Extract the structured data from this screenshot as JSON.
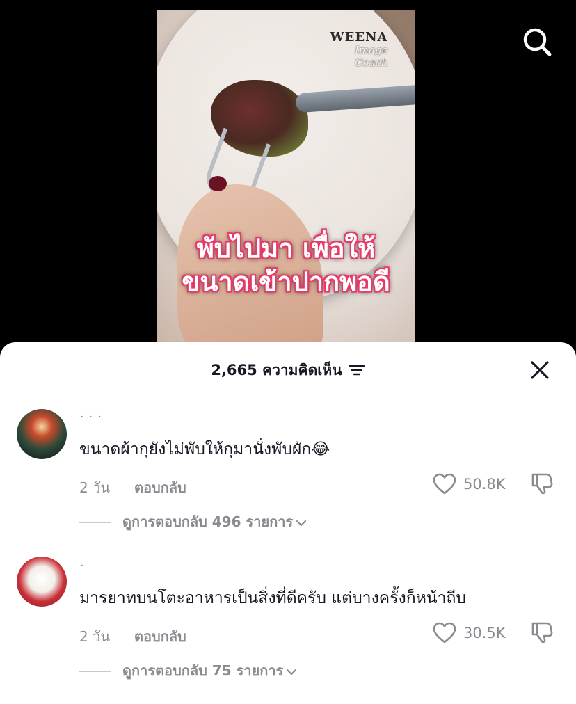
{
  "video": {
    "watermark_line1": "WEENA",
    "watermark_line2": "Image",
    "watermark_line3": "Coach",
    "caption_line1": "พับไปมา เพื่อให้",
    "caption_line2": "ขนาดเข้าปากพอดี"
  },
  "header": {
    "search_icon": "search-icon"
  },
  "comments_sheet": {
    "count_title": "2,665 ความคิดเห็น",
    "filter_icon": "filter-icon",
    "close_icon": "close-icon"
  },
  "comments": [
    {
      "username": "· · ·",
      "text": "ขนาดผ้ากุยังไม่พับให้กุมานั่งพับผัก😂",
      "time": "2 วัน",
      "reply_label": "ตอบกลับ",
      "likes": "50.8K",
      "view_replies": "ดูการตอบกลับ 496 รายการ"
    },
    {
      "username": "·",
      "text": "มารยาทบนโตะอาหารเป็นสิ่งที่ดีครับ แต่บางครั้งก็หน้าถีบ",
      "time": "2 วัน",
      "reply_label": "ตอบกลับ",
      "likes": "30.5K",
      "view_replies": "ดูการตอบกลับ 75 รายการ"
    }
  ],
  "colors": {
    "caption_outline": "#e83a6a",
    "sheet_bg": "#ffffff",
    "text_primary": "#161823",
    "text_secondary": "#8a8b91"
  }
}
